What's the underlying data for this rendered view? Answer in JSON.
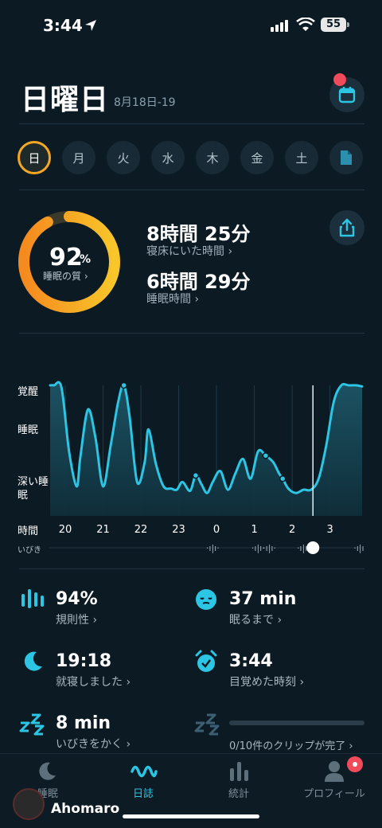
{
  "status_bar": {
    "time": "3:44",
    "battery": "55"
  },
  "header": {
    "title": "日曜日",
    "date_range": "8月18日-19"
  },
  "days": [
    {
      "label": "日",
      "active": true
    },
    {
      "label": "月",
      "active": false
    },
    {
      "label": "火",
      "active": false
    },
    {
      "label": "水",
      "active": false
    },
    {
      "label": "木",
      "active": false
    },
    {
      "label": "金",
      "active": false
    },
    {
      "label": "土",
      "active": false
    }
  ],
  "summary": {
    "score_value": "92",
    "score_unit": "%",
    "score_fraction": 0.92,
    "score_label": "睡眠の質 ›",
    "time_in_bed": "8時間 25分",
    "time_in_bed_label": "寝床にいた時間 ›",
    "sleep_time": "6時間 29分",
    "sleep_time_label": "睡眠時間 ›"
  },
  "chart_data": {
    "type": "area",
    "y_categories": [
      "覚醒",
      "睡眠",
      "深い睡眠"
    ],
    "xlabel": "時間",
    "x_ticks": [
      "20",
      "21",
      "22",
      "23",
      "0",
      "1",
      "2",
      "3"
    ],
    "x": [
      19.6,
      19.7,
      19.9,
      20.1,
      20.3,
      20.4,
      20.6,
      20.8,
      21.0,
      21.2,
      21.4,
      21.55,
      21.7,
      21.9,
      22.1,
      22.2,
      22.4,
      22.6,
      22.8,
      22.95,
      23.1,
      23.3,
      23.45,
      23.6,
      23.75,
      23.9,
      24.1,
      24.3,
      24.5,
      24.7,
      24.9,
      25.1,
      25.3,
      25.5,
      25.65,
      25.75,
      25.9,
      26.1,
      26.3,
      26.5,
      26.7,
      26.9,
      27.1,
      27.3,
      27.5,
      27.7,
      27.85
    ],
    "y": [
      1.0,
      1.0,
      0.98,
      0.4,
      0.08,
      0.35,
      0.78,
      0.52,
      0.08,
      0.45,
      0.85,
      1.0,
      0.72,
      0.12,
      0.3,
      0.6,
      0.28,
      0.08,
      0.06,
      0.05,
      0.12,
      0.04,
      0.18,
      0.1,
      0.02,
      0.12,
      0.22,
      0.05,
      0.2,
      0.33,
      0.15,
      0.4,
      0.36,
      0.3,
      0.2,
      0.15,
      0.06,
      0.02,
      0.05,
      0.05,
      0.15,
      0.45,
      0.85,
      1.0,
      1.0,
      1.0,
      0.99
    ],
    "y_scale_note": "1 = 覚醒, 0 = 深い睡眠",
    "snore_label": "いびき",
    "current_time_x": 26.55
  },
  "metrics": [
    {
      "icon": "regularity-bars-icon",
      "value": "94%",
      "label": "規則性 ›"
    },
    {
      "icon": "sleepy-face-icon",
      "value": "37 min",
      "label": "眠るまで ›"
    },
    {
      "icon": "moon-icon",
      "value": "19:18",
      "label": "就寝しました ›"
    },
    {
      "icon": "alarm-clock-icon",
      "value": "3:44",
      "label": "目覚めた時刻 ›"
    },
    {
      "icon": "zzz-icon",
      "value": "8 min",
      "label": "いびきをかく ›"
    },
    {
      "icon": "zzz-dim-icon",
      "value": "",
      "label": "0/10件のクリップが完了 ›"
    }
  ],
  "tabs": [
    {
      "label": "睡眠",
      "active": false
    },
    {
      "label": "日誌",
      "active": true
    },
    {
      "label": "統計",
      "active": false
    },
    {
      "label": "プロフィール",
      "active": false
    }
  ],
  "watermark": "Ahomaro",
  "colors": {
    "accent": "#2cc5e3",
    "ring": "#f5a623",
    "background": "#0c1a24"
  }
}
